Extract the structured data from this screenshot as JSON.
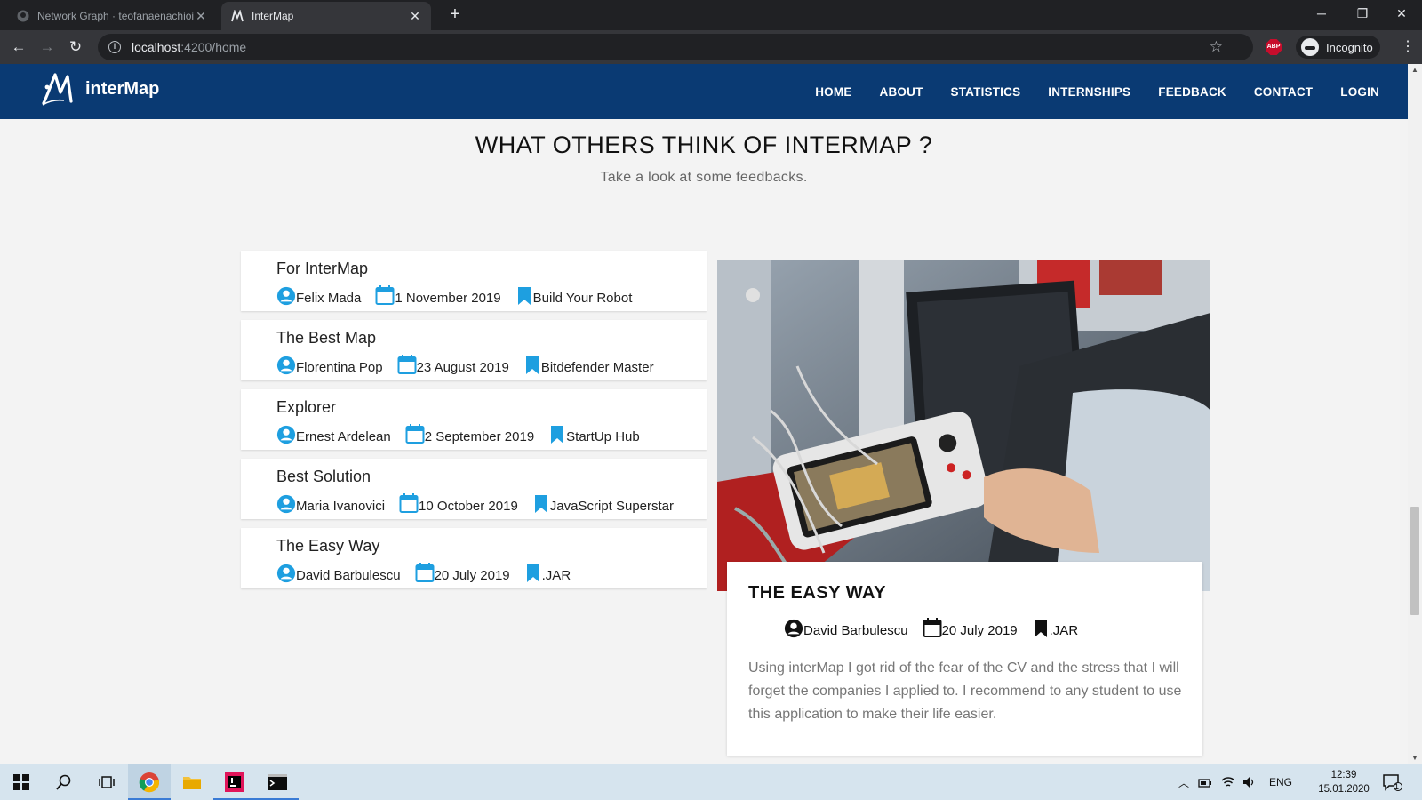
{
  "browser": {
    "tabs": [
      {
        "title": "Network Graph · teofanaenachioiu",
        "active": false
      },
      {
        "title": "InterMap",
        "active": true
      }
    ],
    "url_host": "localhost",
    "url_path": ":4200/home",
    "profile_label": "Incognito",
    "extension_label": "ABP"
  },
  "site": {
    "brand": "interMap",
    "nav": [
      "HOME",
      "ABOUT",
      "STATISTICS",
      "INTERNSHIPS",
      "FEEDBACK",
      "CONTACT",
      "LOGIN"
    ],
    "section_title": "WHAT OTHERS THINK OF INTERMAP ?",
    "section_subtitle": "Take a look at some feedbacks.",
    "feedbacks": [
      {
        "title": "For InterMap",
        "author": "Felix Mada",
        "date": "1 November 2019",
        "internship": "Build Your Robot"
      },
      {
        "title": "The Best Map",
        "author": "Florentina Pop",
        "date": "23 August 2019",
        "internship": "Bitdefender Master"
      },
      {
        "title": "Explorer",
        "author": "Ernest Ardelean",
        "date": "2 September 2019",
        "internship": "StartUp Hub"
      },
      {
        "title": "Best Solution",
        "author": "Maria Ivanovici",
        "date": "10 October 2019",
        "internship": "JavaScript Superstar"
      },
      {
        "title": "The Easy Way",
        "author": "David Barbulescu",
        "date": "20 July 2019",
        "internship": ".JAR"
      }
    ],
    "selected": {
      "title": "THE EASY WAY",
      "author": "David Barbulescu",
      "date": "20 July 2019",
      "internship": ".JAR",
      "text": "Using interMap I got rid of the fear of the CV and the stress that I will forget the companies I applied to. I recommend to any student to use this application to make their life easier."
    },
    "accent_color": "#1e9fe0",
    "navbar_color": "#0a3a73"
  },
  "taskbar": {
    "language": "ENG",
    "time": "12:39",
    "date": "15.01.2020",
    "notification_count": "1"
  }
}
